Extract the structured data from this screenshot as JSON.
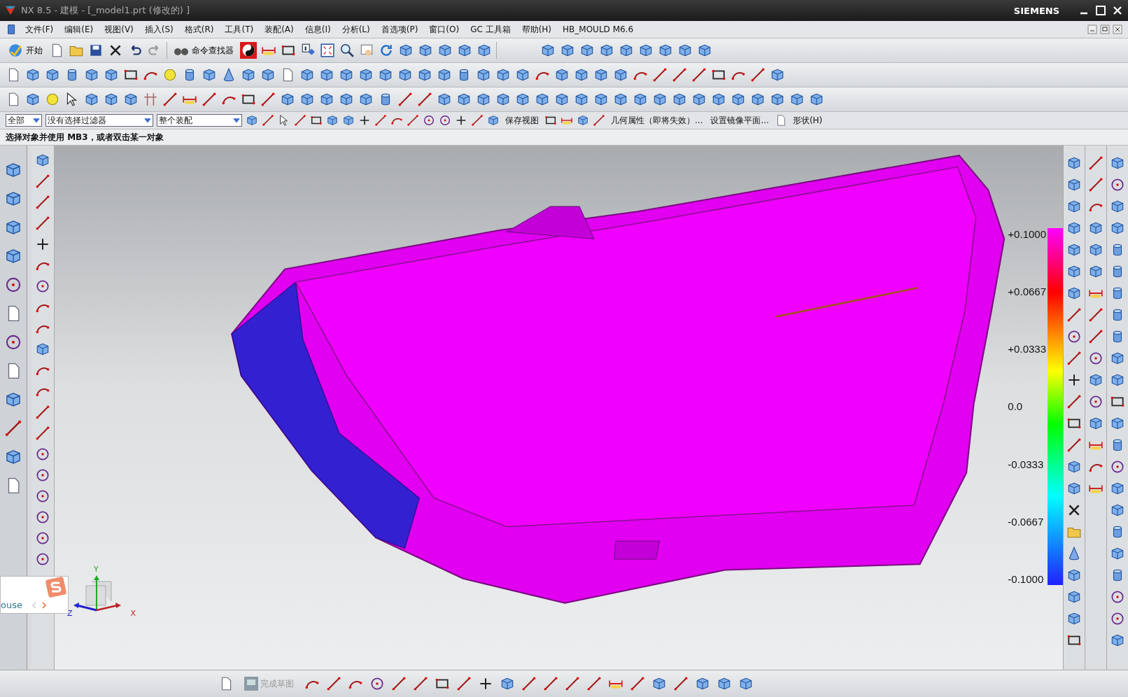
{
  "window": {
    "title": "NX 8.5 - 建模 - [_model1.prt  (修改的) ]",
    "brand": "SIEMENS"
  },
  "menu": [
    {
      "label": "文件(F)"
    },
    {
      "label": "编辑(E)"
    },
    {
      "label": "视图(V)"
    },
    {
      "label": "插入(S)"
    },
    {
      "label": "格式(R)"
    },
    {
      "label": "工具(T)"
    },
    {
      "label": "装配(A)"
    },
    {
      "label": "信息(I)"
    },
    {
      "label": "分析(L)"
    },
    {
      "label": "首选项(P)"
    },
    {
      "label": "窗口(O)"
    },
    {
      "label": "GC 工具箱"
    },
    {
      "label": "帮助(H)"
    },
    {
      "label": "HB_MOULD M6.6"
    }
  ],
  "toolbar": {
    "start": "开始",
    "command_finder": "命令查找器"
  },
  "selection_bar": {
    "type_filter": "全部",
    "filter": "没有选择过滤器",
    "scope": "整个装配",
    "save_view": "保存视图",
    "geometry_props": "几何属性（即将失效）...",
    "mirror_plane": "设置镜像平面...",
    "shape": "形状(H)"
  },
  "prompt": "选择对象并使用 MB3，或者双击某一对象",
  "legend": {
    "ticks": [
      "+0.1000",
      "+0.0667",
      "+0.0333",
      "0.0",
      "-0.0333",
      "-0.0667",
      "-0.1000"
    ]
  },
  "triad": {
    "x": "X",
    "y": "Y",
    "z": "Z"
  },
  "popup": {
    "text": "ouse"
  },
  "sketch_bar": {
    "finish": "完成草图"
  }
}
